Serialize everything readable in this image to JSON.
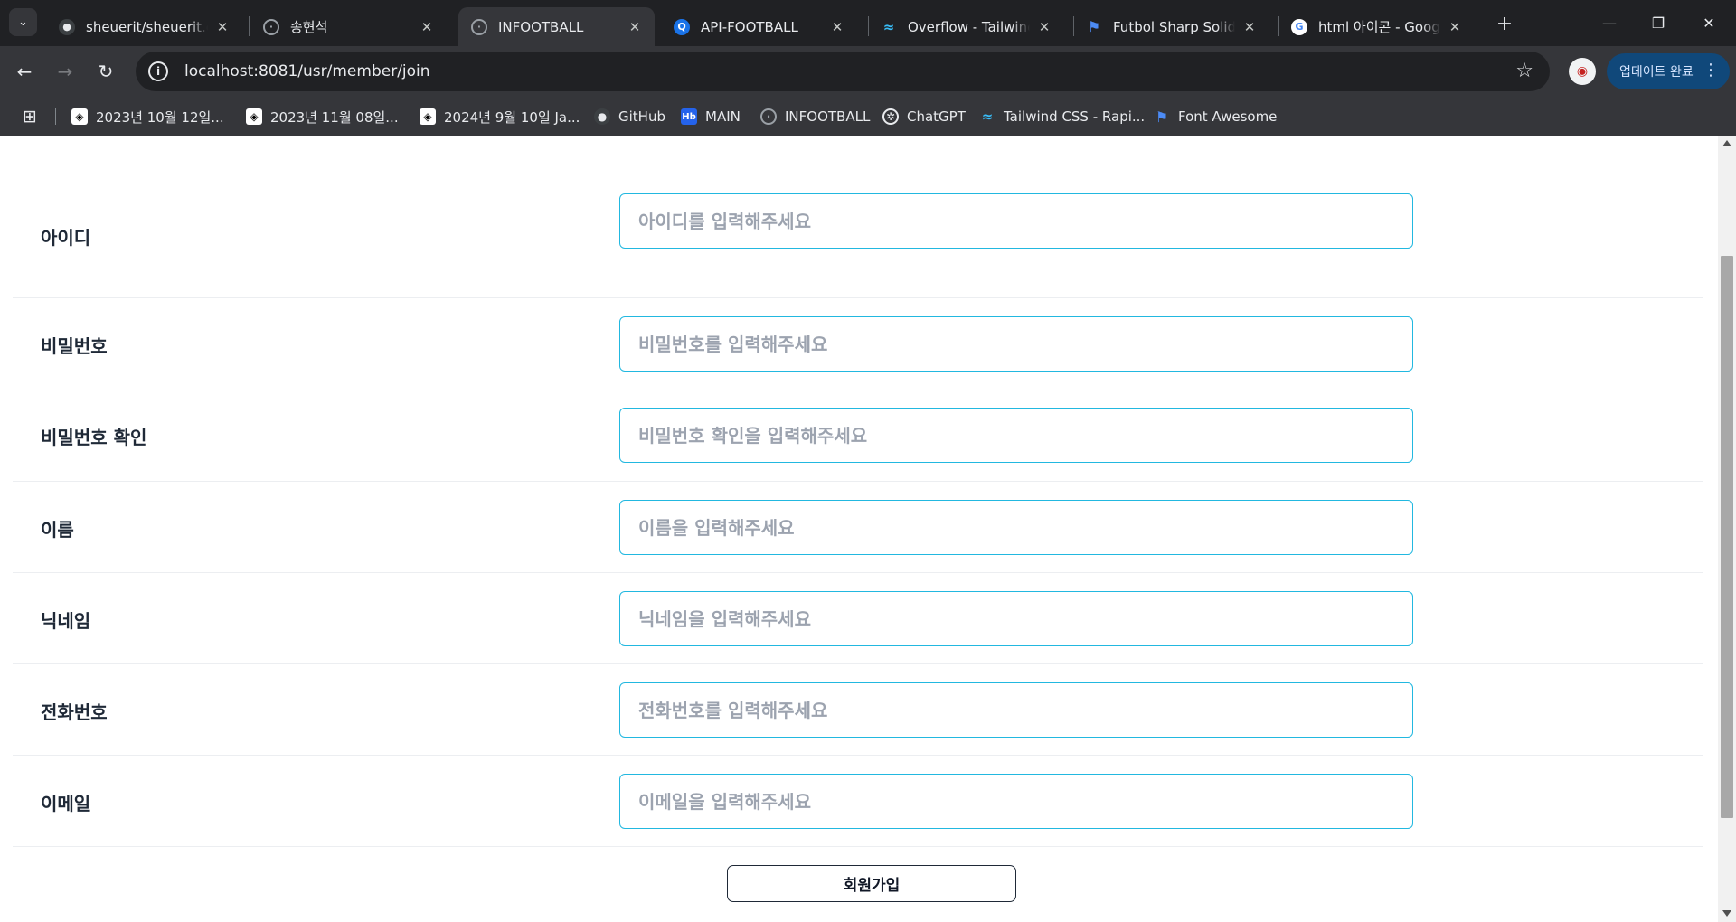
{
  "browser": {
    "tabs": [
      {
        "title": "sheuerit/sheuerit.git",
        "icon": "github-icon",
        "active": false
      },
      {
        "title": "송현석",
        "icon": "globe-icon",
        "active": false
      },
      {
        "title": "INFOOTBALL",
        "icon": "globe-icon",
        "active": true
      },
      {
        "title": "API-FOOTBALL",
        "icon": "api-football-icon",
        "active": false
      },
      {
        "title": "Overflow - Tailwind",
        "icon": "tailwind-icon",
        "active": false
      },
      {
        "title": "Futbol Sharp Solid I",
        "icon": "font-awesome-flag-icon",
        "active": false
      },
      {
        "title": "html 아이콘 - Googl",
        "icon": "google-icon",
        "active": false
      }
    ],
    "url": "localhost:8081/usr/member/join",
    "update_button": "업데이트 완료",
    "bookmarks": [
      {
        "label": "2023년 10월 12일...",
        "icon": "notion-icon"
      },
      {
        "label": "2023년 11월 08일...",
        "icon": "notion-icon"
      },
      {
        "label": "2024년 9월 10일 Ja...",
        "icon": "notion-icon"
      },
      {
        "label": "GitHub",
        "icon": "github-icon"
      },
      {
        "label": "MAIN",
        "icon": "hb-icon"
      },
      {
        "label": "INFOOTBALL",
        "icon": "globe-icon"
      },
      {
        "label": "ChatGPT",
        "icon": "chatgpt-icon"
      },
      {
        "label": "Tailwind CSS - Rapi...",
        "icon": "tailwind-icon"
      },
      {
        "label": "Font Awesome",
        "icon": "font-awesome-flag-icon"
      }
    ]
  },
  "form": {
    "fields": [
      {
        "label": "아이디",
        "placeholder": "아이디를 입력해주세요",
        "value": ""
      },
      {
        "label": "비밀번호",
        "placeholder": "비밀번호를 입력해주세요",
        "value": ""
      },
      {
        "label": "비밀번호 확인",
        "placeholder": "비밀번호 확인을 입력해주세요",
        "value": ""
      },
      {
        "label": "이름",
        "placeholder": "이름을 입력해주세요",
        "value": ""
      },
      {
        "label": "닉네임",
        "placeholder": "닉네임을 입력해주세요",
        "value": ""
      },
      {
        "label": "전화번호",
        "placeholder": "전화번호를 입력해주세요",
        "value": ""
      },
      {
        "label": "이메일",
        "placeholder": "이메일을 입력해주세요",
        "value": ""
      }
    ],
    "submit_label": "회원가입"
  },
  "colors": {
    "input_border": "#22b8e0",
    "browser_frame": "#35363a",
    "tab_strip": "#202124"
  }
}
